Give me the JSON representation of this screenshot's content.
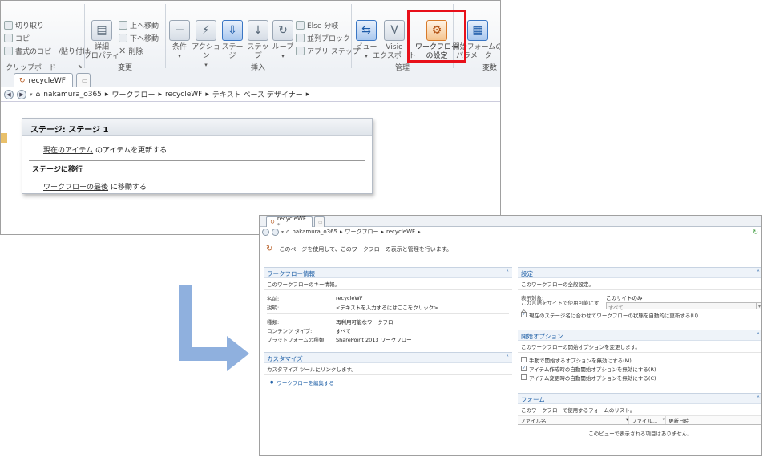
{
  "designer": {
    "ribbon": {
      "clipboard": {
        "cut": "切り取り",
        "copy": "コピー",
        "format_copy": "書式のコピー/貼り付け",
        "group": "クリップボード"
      },
      "edit": {
        "detail_props": "詳細\nプロパティ",
        "move_up": "上へ移動",
        "move_down": "下へ移動",
        "delete": "削除",
        "group": "変更"
      },
      "insert": {
        "condition": "条件",
        "action": "アクション",
        "stage": "ステー\nジ",
        "step": "ステップ",
        "loop": "ループ",
        "else_branch": "Else 分岐",
        "parallel_block": "並列ブロック",
        "app_step": "アプリ ステップ",
        "group": "挿入"
      },
      "manage": {
        "view": "ビュー",
        "visio_export": "Visio\nエクスポート",
        "wf_settings": "ワークフロー\nの設定",
        "group": "管理"
      },
      "variables": {
        "start_form_params": "開始フォームの\nパラメーター",
        "group": "変数"
      }
    },
    "tab": "recycleWF",
    "breadcrumb": [
      "nakamura_o365",
      "ワークフロー",
      "recycleWF",
      "テキスト ベース デザイナー"
    ],
    "stage": {
      "title": "ステージ: ステージ 1",
      "action_link": "現在のアイテム",
      "action_text": " のアイテムを更新する",
      "transition_heading": "ステージに移行",
      "goto_link": "ワークフローの最後",
      "goto_text": " に移動する"
    }
  },
  "settings_page": {
    "tab": "recycleWF *",
    "breadcrumb": [
      "nakamura_o365",
      "ワークフロー",
      "recycleWF"
    ],
    "intro": "このページを使用して、このワークフローの表示と管理を行います。",
    "info": {
      "title": "ワークフロー情報",
      "sub": "このワークフローのキー情報。",
      "rows": [
        {
          "k": "名前:",
          "v": "recycleWF"
        },
        {
          "k": "説明:",
          "v": "<テキストを入力するにはここをクリック>"
        },
        {
          "k": "種類:",
          "v": "再利用可能なワークフロー"
        },
        {
          "k": "コンテンツ タイプ:",
          "v": "すべて"
        },
        {
          "k": "プラットフォームの種類:",
          "v": "SharePoint 2013 ワークフロー"
        }
      ]
    },
    "customize": {
      "title": "カスタマイズ",
      "sub": "カスタマイズ ツールにリンクします。",
      "edit_link": "ワークフローを編集する"
    },
    "settings": {
      "title": "設定",
      "sub": "このワークフローの全般設定。",
      "show_on_label": "表示対象:",
      "show_on_value": "このサイトのみ",
      "lang_label": "この言語をサイトで使用可能にする:",
      "lang_value": "すべて",
      "auto_update": "現在のステージ名に合わせてワークフローの状態を自動的に更新する(U)"
    },
    "start_options": {
      "title": "開始オプション",
      "sub": "このワークフローの開始オプションを変更します。",
      "opt_manual": "手動で開始するオプションを無効にする(M)",
      "opt_create": "アイテム作成時の自動開始オプションを無効にする(R)",
      "opt_change": "アイテム変更時の自動開始オプションを無効にする(C)"
    },
    "forms": {
      "title": "フォーム",
      "sub": "このワークフローで使用するフォームのリスト。",
      "col_file_name": "ファイル名",
      "col_file": "ファイル...",
      "col_modified": "更新日時",
      "empty": "このビューで表示される項目はありません。"
    }
  }
}
